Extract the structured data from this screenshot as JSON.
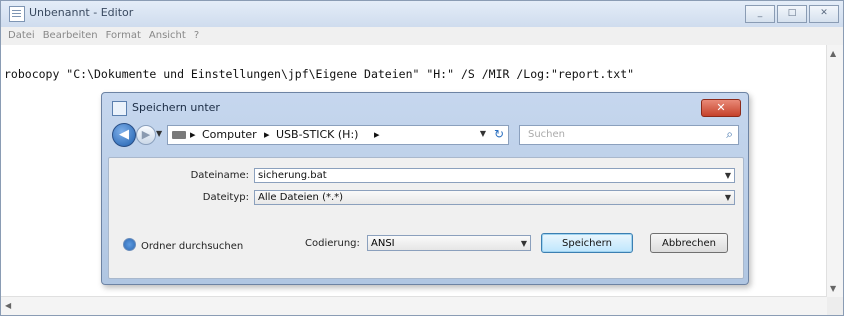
{
  "window": {
    "title": "Unbenannt - Editor",
    "controls": [
      "_",
      "□",
      "✕"
    ]
  },
  "menu": [
    "Datei",
    "Bearbeiten",
    "Format",
    "Ansicht",
    "?"
  ],
  "editor": {
    "text": "robocopy \"C:\\Dokumente und Einstellungen\\jpf\\Eigene Dateien\" \"H:\" /S /MIR /Log:\"report.txt\""
  },
  "dialog": {
    "title": "Speichern unter",
    "close_label": "✕",
    "address": {
      "crumbs": [
        "Computer",
        "USB-STICK (H:)"
      ]
    },
    "search_placeholder": "Suchen",
    "filename_label": "Dateiname:",
    "filename_value": "sicherung.bat",
    "filetype_label": "Dateityp:",
    "filetype_value": "Alle Dateien (*.*)",
    "hide_folders_label": "Ordner durchsuchen",
    "encoding_label": "Codierung:",
    "encoding_value": "ANSI",
    "save_label": "Speichern",
    "cancel_label": "Abbrechen"
  }
}
